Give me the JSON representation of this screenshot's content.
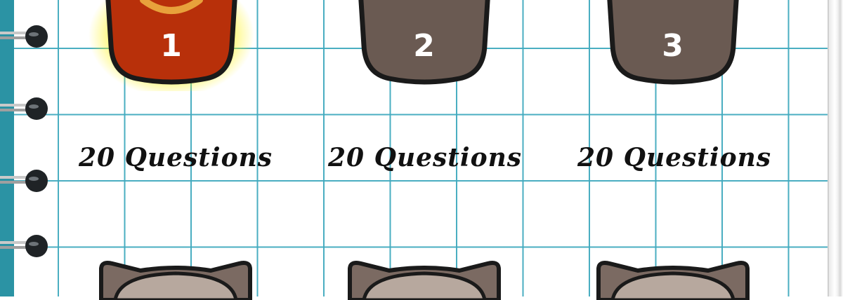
{
  "levels": [
    {
      "number": "1",
      "questions_label": "20 Questions",
      "state": "selected",
      "color": "#b8300a"
    },
    {
      "number": "2",
      "questions_label": "20 Questions",
      "state": "locked",
      "color": "#6a5a52"
    },
    {
      "number": "3",
      "questions_label": "20 Questions",
      "state": "locked",
      "color": "#6a5a52"
    }
  ],
  "next_row": [
    {
      "state": "locked"
    },
    {
      "state": "locked"
    },
    {
      "state": "locked"
    }
  ],
  "colors": {
    "spiral_edge": "#2b93a4",
    "grid_line": "#40aabe",
    "selected_glow": "#fff200"
  }
}
